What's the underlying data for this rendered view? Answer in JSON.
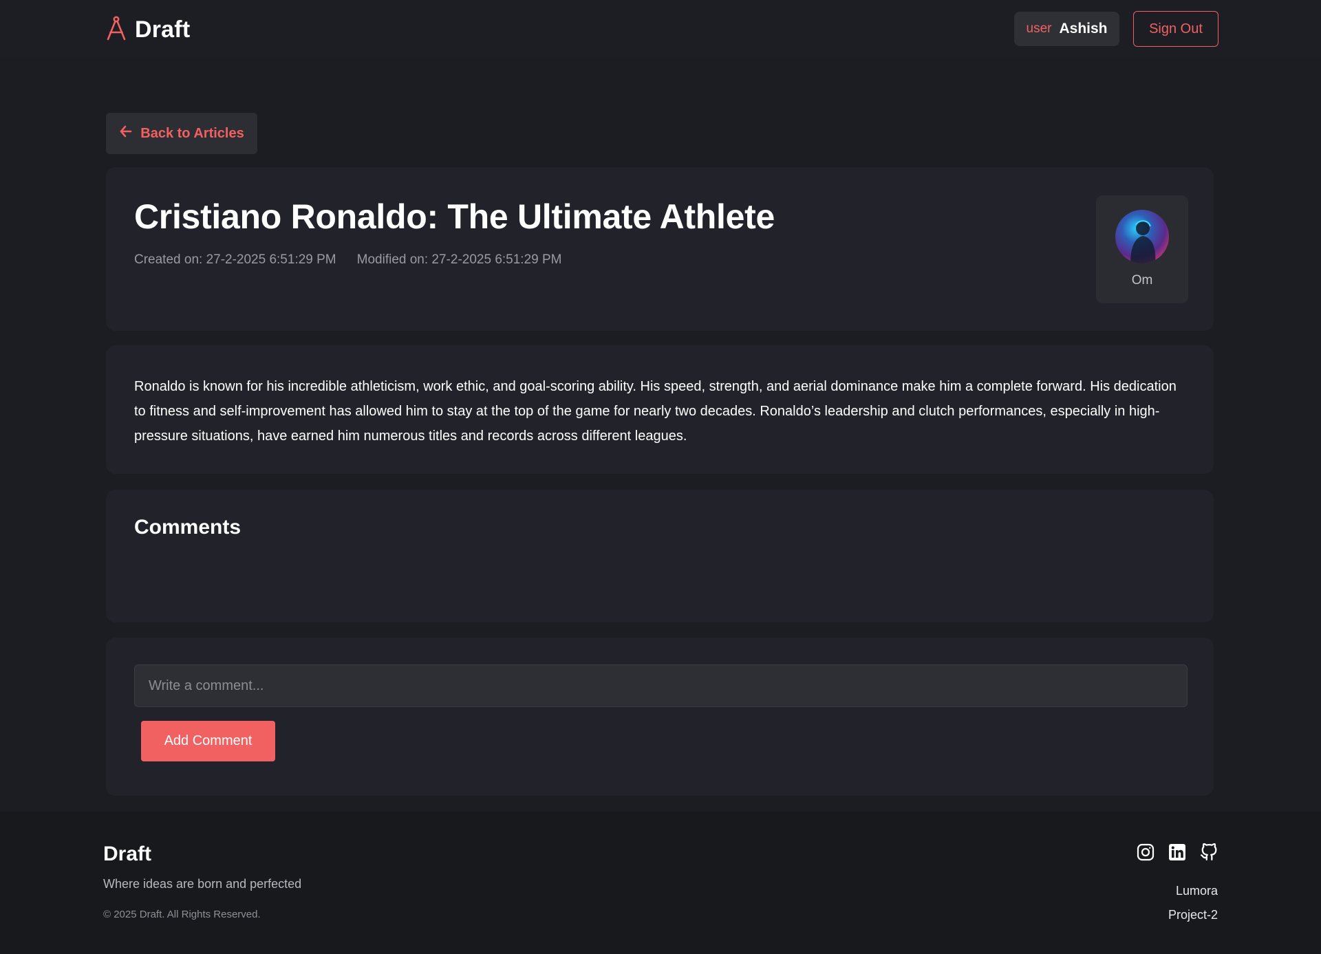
{
  "header": {
    "brand": "Draft",
    "user_role": "user",
    "user_name": "Ashish",
    "signout_label": "Sign Out"
  },
  "back_label": "Back to Articles",
  "article": {
    "title": "Cristiano Ronaldo: The Ultimate Athlete",
    "created": "Created on: 27-2-2025 6:51:29 PM",
    "modified": "Modified on: 27-2-2025 6:51:29 PM",
    "author": "Om",
    "body": "Ronaldo is known for his incredible athleticism, work ethic, and goal-scoring ability. His speed, strength, and aerial dominance make him a complete forward. His dedication to fitness and self-improvement has allowed him to stay at the top of the game for nearly two decades. Ronaldo’s leadership and clutch performances, especially in high-pressure situations, have earned him numerous titles and records across different leagues."
  },
  "comments": {
    "title": "Comments",
    "input_placeholder": "Write a comment...",
    "input_value": "",
    "add_label": "Add Comment"
  },
  "footer": {
    "brand": "Draft",
    "tagline": "Where ideas are born and perfected",
    "copyright": "© 2025 Draft. All Rights Reserved.",
    "social_icons": [
      "instagram-icon",
      "linkedin-icon",
      "github-icon"
    ],
    "links": [
      "Lumora",
      "Project-2"
    ]
  },
  "colors": {
    "accent": "#f26161",
    "background": "#1c1d22",
    "card": "#22232a",
    "footer": "#18191d"
  }
}
